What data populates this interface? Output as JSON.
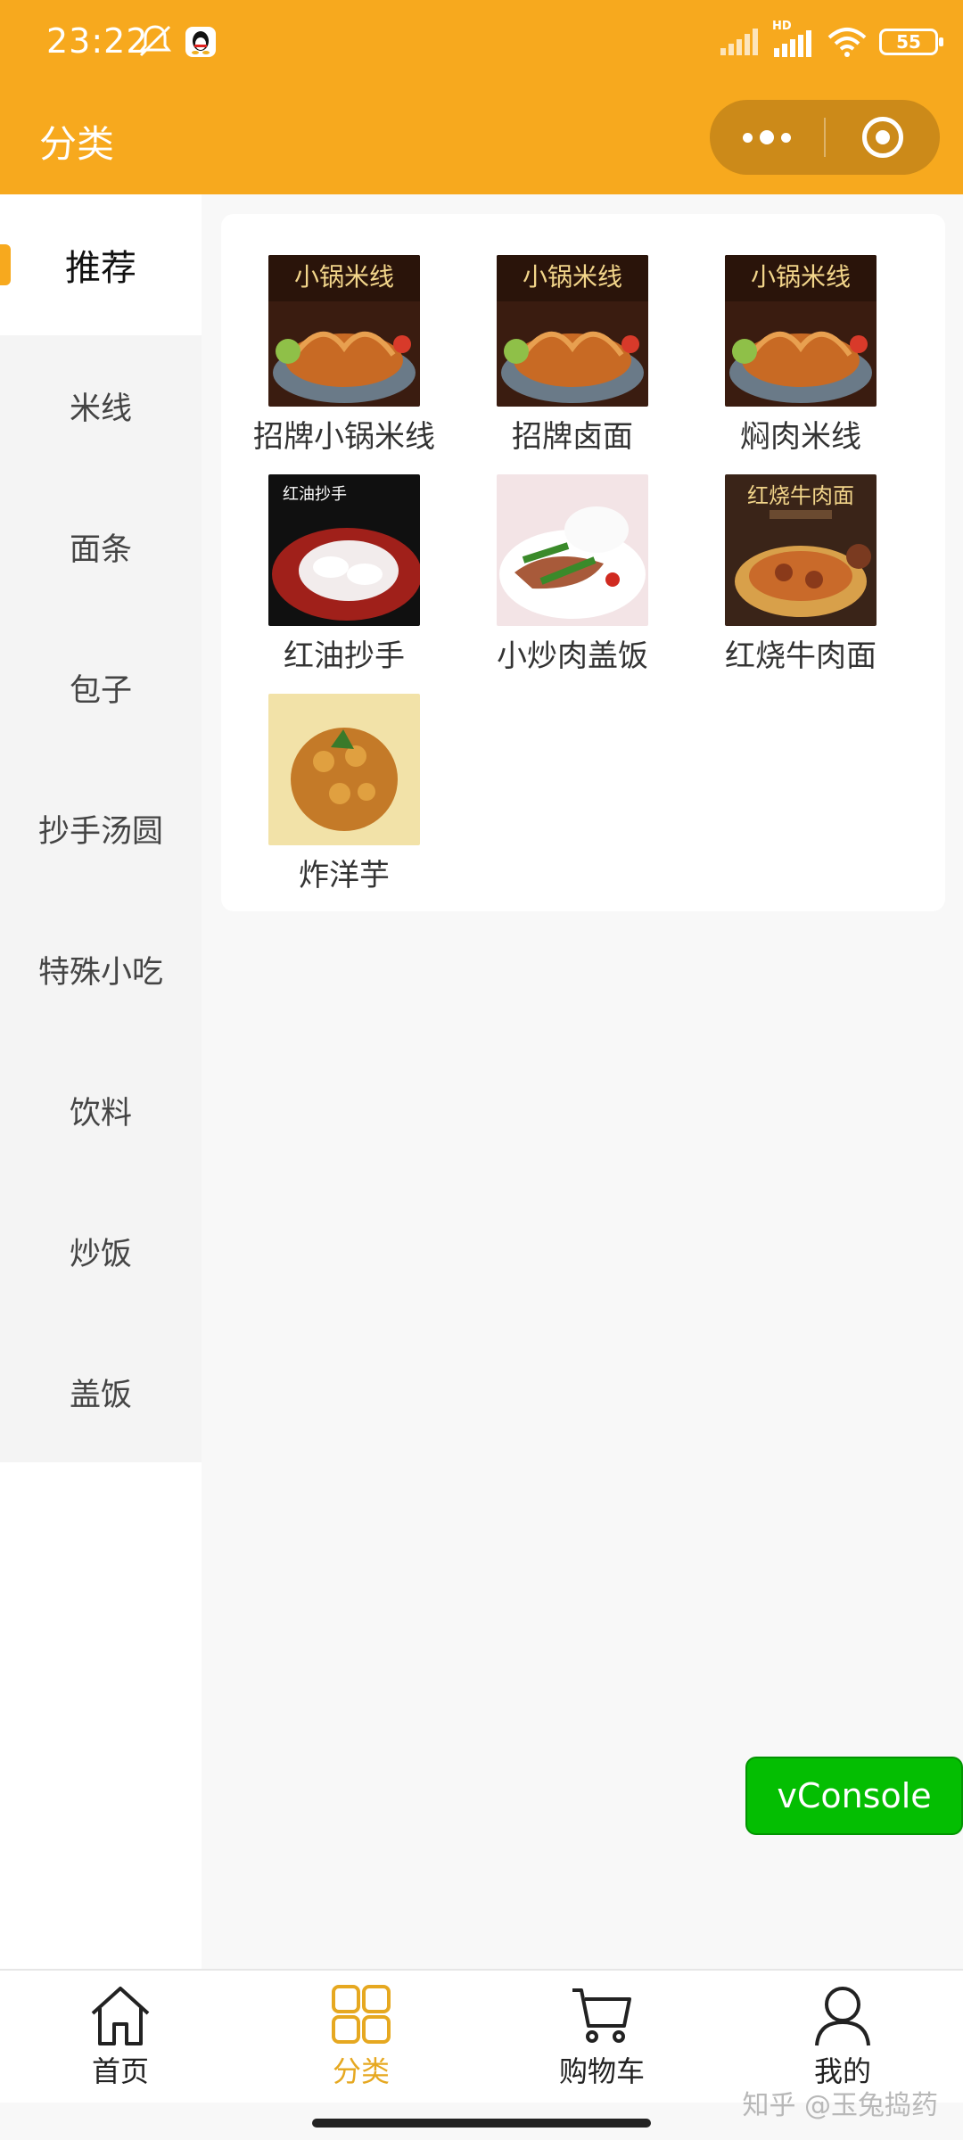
{
  "status_bar": {
    "time": "23:22",
    "battery": "55",
    "network": "HD"
  },
  "header": {
    "title": "分类"
  },
  "sidebar": {
    "items": [
      {
        "label": "推荐",
        "active": true
      },
      {
        "label": "米线"
      },
      {
        "label": "面条"
      },
      {
        "label": "包子"
      },
      {
        "label": "抄手汤圆"
      },
      {
        "label": "特殊小吃"
      },
      {
        "label": "饮料"
      },
      {
        "label": "炒饭"
      },
      {
        "label": "盖饭"
      }
    ]
  },
  "products": [
    {
      "name": "招牌小锅米线",
      "image_text": "小锅米线"
    },
    {
      "name": "招牌卤面",
      "image_text": "小锅米线"
    },
    {
      "name": "焖肉米线",
      "image_text": "小锅米线"
    },
    {
      "name": "红油抄手",
      "image_text": "红油抄手"
    },
    {
      "name": "小炒肉盖饭"
    },
    {
      "name": "红烧牛肉面",
      "image_text": "红烧牛肉面"
    },
    {
      "name": "炸洋芋"
    }
  ],
  "vconsole": {
    "label": "vConsole"
  },
  "tabbar": {
    "items": [
      {
        "label": "首页",
        "icon": "home-icon"
      },
      {
        "label": "分类",
        "icon": "grid-icon",
        "active": true
      },
      {
        "label": "购物车",
        "icon": "cart-icon"
      },
      {
        "label": "我的",
        "icon": "user-icon"
      }
    ]
  },
  "watermark": "知乎 @玉兔捣药",
  "colors": {
    "theme": "#f7a91e",
    "tab_active": "#e6a820",
    "vconsole": "#04be02"
  }
}
